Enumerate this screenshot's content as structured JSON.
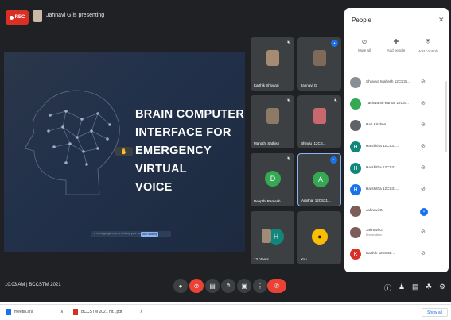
{
  "meeting": {
    "record_label": "REC",
    "presenting_text": "Jahnavi G is presenting",
    "slide_title_lines": [
      "BRAIN COMPUTER",
      "INTERFACE FOR",
      "EMERGENCY VIRTUAL",
      "VOICE"
    ],
    "presenter_chip": "✋",
    "slide_bar_text": "● meet.google.com is sharing your screen",
    "slide_bar_button": "Stop sharing",
    "time_code": "10:03 AM | BCCSTM 2021"
  },
  "tiles": [
    {
      "name": "Karthik Shivaraj"
    },
    {
      "name": "Jahnavi G"
    },
    {
      "name": "Mahathi Sathish"
    },
    {
      "name": "Bhindu_12CS..."
    },
    {
      "name": "Deepthi Ramesh...",
      "initial": "D"
    },
    {
      "name": "Arpitha_12CS31...",
      "initial": "A"
    },
    {
      "name": "13 others",
      "initial": "H"
    },
    {
      "name": "You"
    }
  ],
  "people_panel": {
    "title": "People",
    "close": "✕",
    "tools": [
      {
        "label": "Mute all",
        "icon": "mic-off-icon"
      },
      {
        "label": "Add people",
        "icon": "add-person-icon"
      },
      {
        "label": "Host controls",
        "icon": "shield-icon"
      }
    ],
    "participants": [
      {
        "name": "Shravya Mahesh 12CS31...",
        "initial": "",
        "color": "#8a8f96"
      },
      {
        "name": "Yashwanth Kumar 12CS...",
        "initial": "",
        "color": "#34a853"
      },
      {
        "name": "Hari Krishna",
        "initial": "",
        "color": "#5f6368"
      },
      {
        "name": "Harshitha 12CS31...",
        "initial": "H",
        "color": "#12867a"
      },
      {
        "name": "Harshitha 12CS31...",
        "initial": "H",
        "color": "#12867a"
      },
      {
        "name": "Harshitha 12CS31...",
        "initial": "H",
        "color": "#1a73e8"
      },
      {
        "name": "Jahnavi G",
        "initial": "",
        "color": "#7b5e57"
      },
      {
        "name": "Jahnavi G",
        "sub": "Presentation",
        "initial": "",
        "color": "#7b5e57"
      },
      {
        "name": "Karthik 12CS31...",
        "initial": "K",
        "color": "#d93025"
      }
    ]
  },
  "downloads": {
    "items": [
      {
        "name": "meetin.ara"
      },
      {
        "name": "BCCSTM 2021 hlt...pdf"
      }
    ],
    "show_all": "Show all"
  },
  "colors": {
    "meet_bg": "#202124",
    "record_red": "#d93025",
    "hangup_red": "#ea4335",
    "accent_blue": "#1a73e8"
  }
}
